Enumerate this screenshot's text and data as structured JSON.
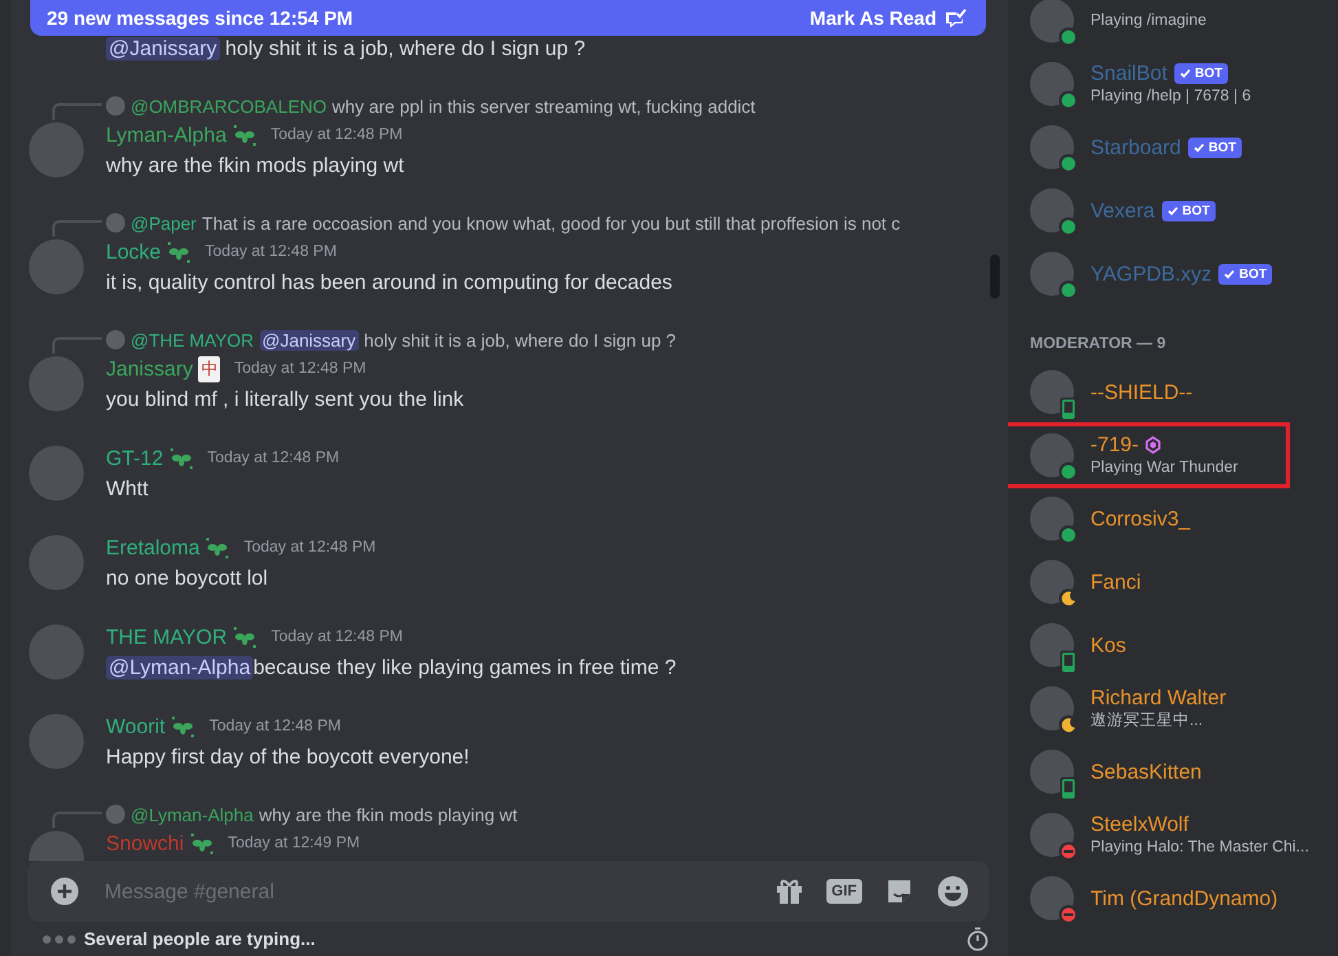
{
  "banner": {
    "text": "29 new messages since 12:54 PM",
    "action": "Mark As Read"
  },
  "messages": [
    {
      "kind": "continuation",
      "mention": "@Janissary",
      "text": "holy shit it is a job, where do I sign up ?"
    },
    {
      "kind": "message",
      "author": "Lyman-Alpha",
      "color": "#3ba55c",
      "badge": {
        "kind": "leaf"
      },
      "time": "Today at 12:48 PM",
      "text": "why are the fkin mods playing wt",
      "reply": {
        "author": "@OMBRARCOBALENO",
        "color": "#3ba55c",
        "text": "why are ppl in this server streaming wt, fucking addict"
      }
    },
    {
      "kind": "message",
      "author": "Locke",
      "color": "#2fb07a",
      "badge": {
        "kind": "leaf"
      },
      "time": "Today at 12:48 PM",
      "text": "it is, quality control has been around in computing for decades",
      "reply": {
        "author": "@Paper",
        "color": "#2fb07a",
        "text": "That is a rare occoasion and you know what, good for you but still that proffesion is not c"
      }
    },
    {
      "kind": "message",
      "author": "Janissary",
      "color": "#3ba55c",
      "badge": {
        "kind": "tile",
        "text": "中"
      },
      "time": "Today at 12:48 PM",
      "text": "you blind mf , i literally sent you the link",
      "reply": {
        "author": "@THE MAYOR",
        "color": "#2fb07a",
        "mention": "@Janissary",
        "text": "holy shit it is a job, where do I sign up ?"
      }
    },
    {
      "kind": "message",
      "author": "GT-12",
      "color": "#2fb07a",
      "badge": {
        "kind": "leaf"
      },
      "time": "Today at 12:48 PM",
      "text": "Whtt"
    },
    {
      "kind": "message",
      "author": "Eretaloma",
      "color": "#2fb07a",
      "badge": {
        "kind": "leaf"
      },
      "time": "Today at 12:48 PM",
      "text": "no one boycott lol"
    },
    {
      "kind": "message",
      "author": "THE MAYOR",
      "color": "#2fb07a",
      "badge": {
        "kind": "leaf"
      },
      "time": "Today at 12:48 PM",
      "mention": "@Lyman-Alpha",
      "text": "because they like playing games in free time ?"
    },
    {
      "kind": "message",
      "author": "Woorit",
      "color": "#2fb07a",
      "badge": {
        "kind": "leaf"
      },
      "time": "Today at 12:48 PM",
      "text": "Happy first day of the boycott everyone!"
    },
    {
      "kind": "message",
      "author": "Snowchi",
      "color": "#c0392b",
      "badge": {
        "kind": "leaf"
      },
      "time": "Today at 12:49 PM",
      "reply": {
        "author": "@Lyman-Alpha",
        "color": "#3ba55c",
        "text": "why are the fkin mods playing wt"
      }
    }
  ],
  "composer": {
    "placeholder": "Message #general",
    "gif": "GIF"
  },
  "typing": "Several people are typing...",
  "members": [
    {
      "presence": {
        "kind": "online"
      },
      "activity": "Playing /imagine",
      "highlighted": false
    },
    {
      "name": "SnailBot",
      "color": "#3c6a9c",
      "presence": {
        "kind": "online"
      },
      "bot": "BOT",
      "activity": "Playing /help | 7678 | 6",
      "highlighted": false
    },
    {
      "name": "Starboard",
      "color": "#3c6a9c",
      "presence": {
        "kind": "online"
      },
      "bot": "BOT",
      "highlighted": false
    },
    {
      "name": "Vexera",
      "color": "#3c6a9c",
      "presence": {
        "kind": "online"
      },
      "bot": "BOT",
      "highlighted": false
    },
    {
      "name": "YAGPDB.xyz",
      "color": "#3c6a9c",
      "presence": {
        "kind": "online"
      },
      "bot": "BOT",
      "highlighted": false
    },
    {
      "kind": "header",
      "label": "MODERATOR — 9"
    },
    {
      "name": "--SHIELD--",
      "color": "#e8922a",
      "presence": {
        "kind": "mobile"
      },
      "highlighted": false
    },
    {
      "name": "-719-",
      "color": "#e8922a",
      "presence": {
        "kind": "online"
      },
      "gem": true,
      "activity": "Playing War Thunder",
      "highlighted": true
    },
    {
      "name": "Corrosiv3_",
      "color": "#e8922a",
      "presence": {
        "kind": "online"
      },
      "highlighted": false
    },
    {
      "name": "Fanci",
      "color": "#e8922a",
      "presence": {
        "kind": "idle"
      },
      "highlighted": false
    },
    {
      "name": "Kos",
      "color": "#e8922a",
      "presence": {
        "kind": "mobile"
      },
      "highlighted": false
    },
    {
      "name": "Richard Walter",
      "color": "#e8922a",
      "presence": {
        "kind": "idle"
      },
      "activity": "遨游冥王星中...",
      "highlighted": false
    },
    {
      "name": "SebasKitten",
      "color": "#e8922a",
      "presence": {
        "kind": "mobile"
      },
      "highlighted": false
    },
    {
      "name": "SteelxWolf",
      "color": "#e8922a",
      "presence": {
        "kind": "dnd"
      },
      "activity": "Playing Halo: The Master Chi...",
      "highlighted": false
    },
    {
      "name": "Tim (GrandDynamo)",
      "color": "#e8922a",
      "presence": {
        "kind": "dnd"
      },
      "highlighted": false
    }
  ]
}
